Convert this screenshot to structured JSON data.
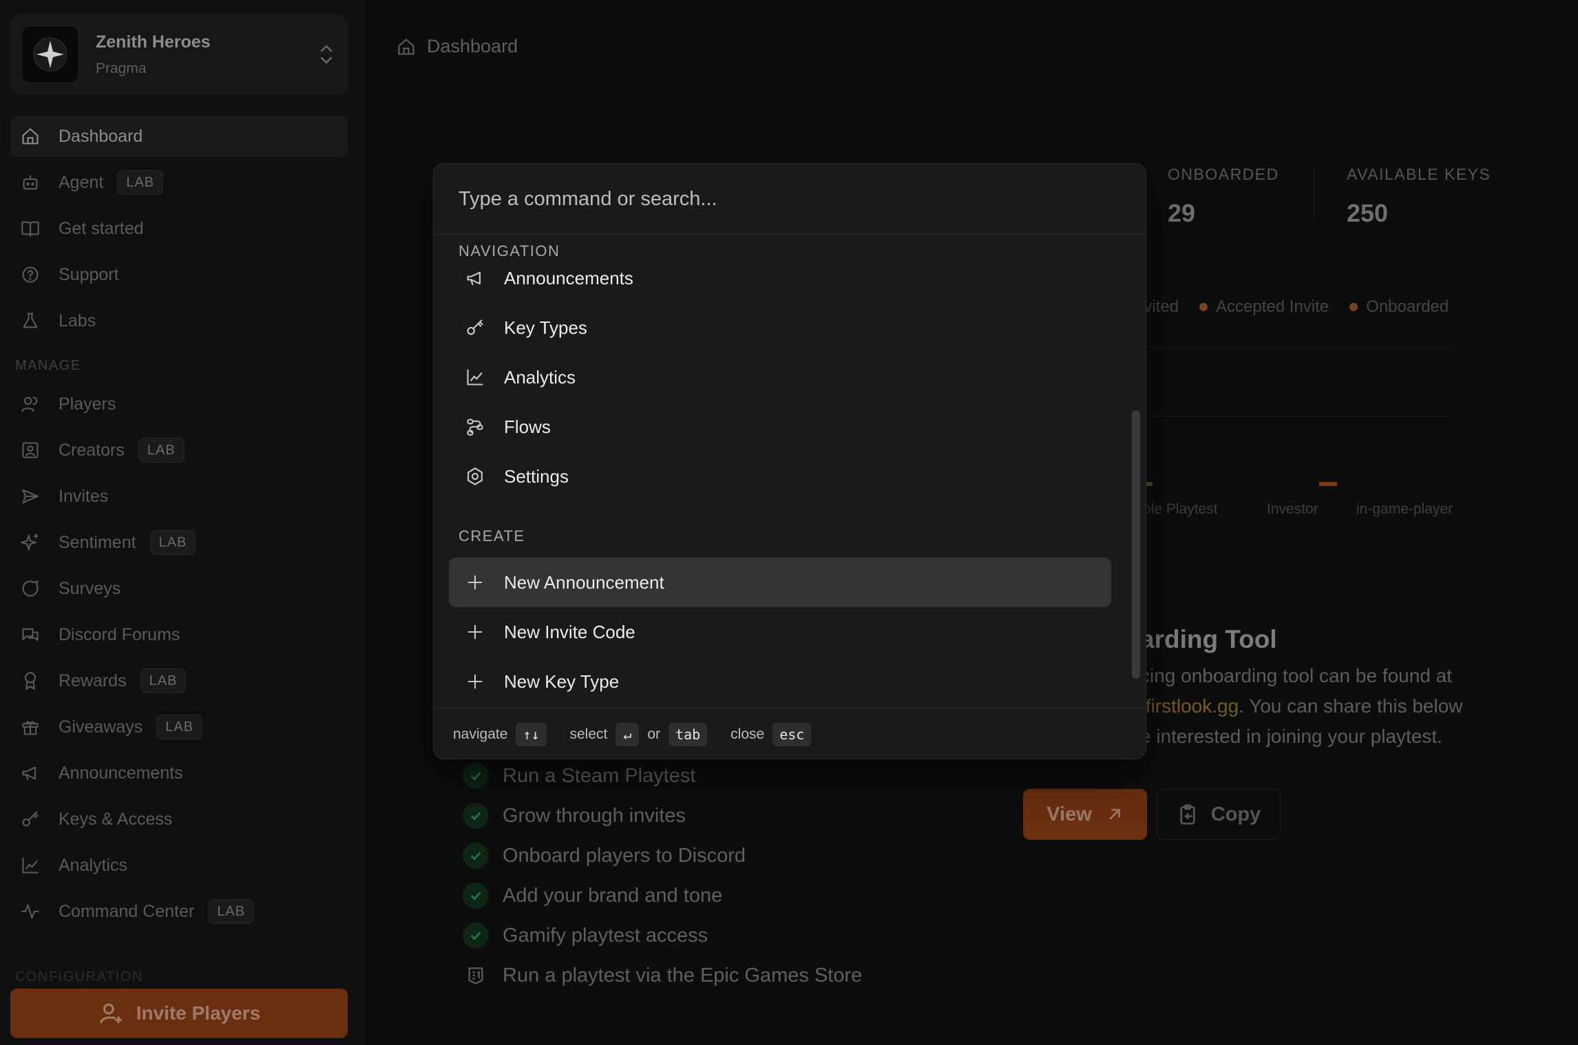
{
  "workspace": {
    "name": "Zenith Heroes",
    "org": "Pragma"
  },
  "nav": {
    "items": [
      {
        "label": "Dashboard"
      },
      {
        "label": "Agent",
        "badge": "LAB"
      },
      {
        "label": "Get started"
      },
      {
        "label": "Support"
      },
      {
        "label": "Labs"
      }
    ],
    "manage_label": "MANAGE",
    "manage_items": [
      {
        "label": "Players"
      },
      {
        "label": "Creators",
        "badge": "LAB"
      },
      {
        "label": "Invites"
      },
      {
        "label": "Sentiment",
        "badge": "LAB"
      },
      {
        "label": "Surveys"
      },
      {
        "label": "Discord Forums"
      },
      {
        "label": "Rewards",
        "badge": "LAB"
      },
      {
        "label": "Giveaways",
        "badge": "LAB"
      },
      {
        "label": "Announcements"
      },
      {
        "label": "Keys & Access"
      },
      {
        "label": "Analytics"
      },
      {
        "label": "Command Center",
        "badge": "LAB"
      }
    ],
    "config_label": "CONFIGURATION",
    "invite_button": "Invite Players"
  },
  "header": {
    "breadcrumb": "Dashboard"
  },
  "stats": [
    {
      "label": "ONBOARDED",
      "value": "29"
    },
    {
      "label": "AVAILABLE KEYS",
      "value": "250"
    }
  ],
  "legend": [
    "nvited",
    "Accepted Invite",
    "Onboarded"
  ],
  "chart_ticks": [
    "ole Playtest",
    "Investor",
    "in-game-player"
  ],
  "tool": {
    "title": "arding Tool",
    "line1": "cing onboarding tool can be found at",
    "link": ".firstlook.gg",
    "line2_rest": ". You can share this below",
    "line3": "e interested in joining your playtest.",
    "view_label": "View",
    "copy_label": "Copy"
  },
  "checklist": [
    {
      "label": "Run a Steam Playtest",
      "done": true
    },
    {
      "label": "Grow through invites",
      "done": true
    },
    {
      "label": "Onboard players to Discord",
      "done": true
    },
    {
      "label": "Add your brand and tone",
      "done": true
    },
    {
      "label": "Gamify playtest access",
      "done": true
    },
    {
      "label": "Run a playtest via the Epic Games Store",
      "done": false
    }
  ],
  "palette": {
    "placeholder": "Type a command or search...",
    "navigation_label": "NAVIGATION",
    "navigation": [
      "Announcements",
      "Key Types",
      "Analytics",
      "Flows",
      "Settings"
    ],
    "create_label": "CREATE",
    "create": [
      "New Announcement",
      "New Invite Code",
      "New Key Type"
    ],
    "footer": {
      "navigate": "navigate",
      "navigate_key": "↑↓",
      "select": "select",
      "select_key": "↵",
      "or": "or",
      "tab_key": "tab",
      "close": "close",
      "close_key": "esc"
    }
  },
  "colors": {
    "accent": "#c2521c",
    "selected_row": "#333333"
  }
}
